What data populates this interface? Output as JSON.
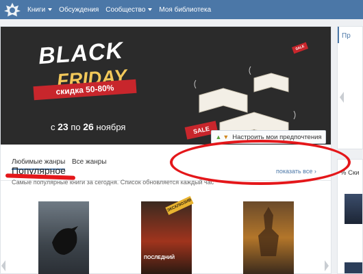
{
  "nav": {
    "items": [
      {
        "label": "Книги",
        "has_caret": true
      },
      {
        "label": "Обсуждения",
        "has_caret": false
      },
      {
        "label": "Сообщество",
        "has_caret": true
      },
      {
        "label": "Моя библиотека",
        "has_caret": false
      }
    ]
  },
  "banner": {
    "line1": "BLACK",
    "line2": "FRIDAY",
    "discount": "скидка 50-80%",
    "dates_prefix": "с",
    "date_from": "23",
    "dates_mid": "по",
    "date_to": "26",
    "dates_suffix": "ноября",
    "sale_tag": "SALE",
    "sale_tag_small": "SALE"
  },
  "tabs": {
    "favorites": "Любимые жанры",
    "all": "Все жанры",
    "preferences_button": "Настроить мои предпочтения"
  },
  "popular": {
    "title": "Популярное",
    "subtitle": "Самые популярные книги за сегодня. Список обновляется каждый час",
    "show_all": "показать все",
    "show_all_arrow": "›",
    "books": [
      {
        "cover_text": ""
      },
      {
        "cover_text": "ПОСЛЕДНИЙ",
        "badge": "ЭКСКЛЮЗИВ"
      },
      {
        "cover_text": ""
      }
    ]
  },
  "sidebar": {
    "box1_label": "Пр",
    "box2_label": "% Ски"
  },
  "colors": {
    "nav_bg": "#4b77a7",
    "accent": "#4b77a7",
    "sale_red": "#c8262c",
    "annotation_red": "#e4171a",
    "friday_gold": "#f2c85a"
  }
}
